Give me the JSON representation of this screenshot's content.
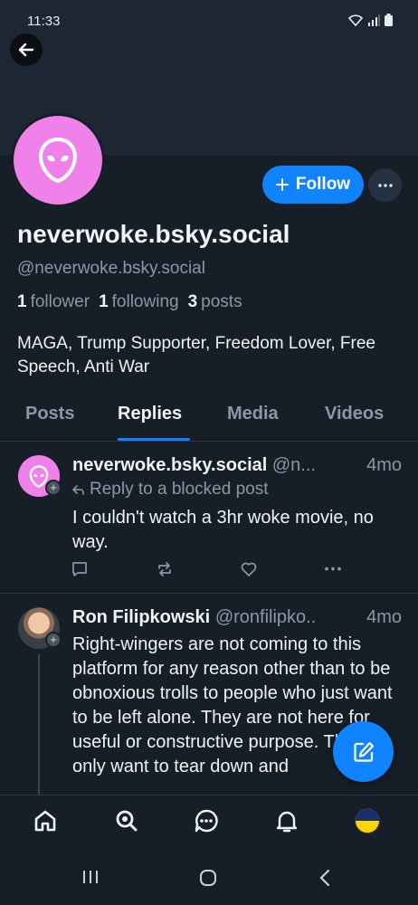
{
  "status_bar": {
    "time": "11:33"
  },
  "profile": {
    "display_name": "neverwoke.bsky.social",
    "handle": "@neverwoke.bsky.social",
    "follow_label": "Follow",
    "stats": {
      "followers": "1",
      "followers_label": "follower",
      "following": "1",
      "following_label": "following",
      "posts": "3",
      "posts_label": "posts"
    },
    "bio": "MAGA, Trump Supporter, Freedom Lover, Free Speech, Anti War"
  },
  "tabs": [
    {
      "label": "Posts"
    },
    {
      "label": "Replies",
      "active": true
    },
    {
      "label": "Media"
    },
    {
      "label": "Videos"
    }
  ],
  "posts": [
    {
      "author": "neverwoke.bsky.social",
      "handle": "@n...",
      "time": "4mo",
      "reply_note": "Reply to a blocked post",
      "text": "I couldn't watch a 3hr woke movie, no way."
    },
    {
      "author": "Ron Filipkowski",
      "handle": "@ronfilipko..",
      "time": "4mo",
      "text": "Right-wingers are not coming to this platform for any reason other than to be obnoxious trolls to people who just want to be left alone. They are not here for useful or constructive purpose. They only want to tear down and"
    }
  ],
  "colors": {
    "accent": "#1083fe",
    "avatar_pink": "#f081ea",
    "background": "#161e27"
  },
  "icons": [
    "back-arrow-icon",
    "alien-icon",
    "plus-icon",
    "ellipsis-icon",
    "reply-arrow-icon",
    "comment-icon",
    "repost-icon",
    "heart-icon",
    "compose-icon",
    "home-icon",
    "search-icon",
    "chat-icon",
    "bell-icon",
    "recents-icon",
    "home-circle-icon",
    "back-chevron-icon"
  ]
}
